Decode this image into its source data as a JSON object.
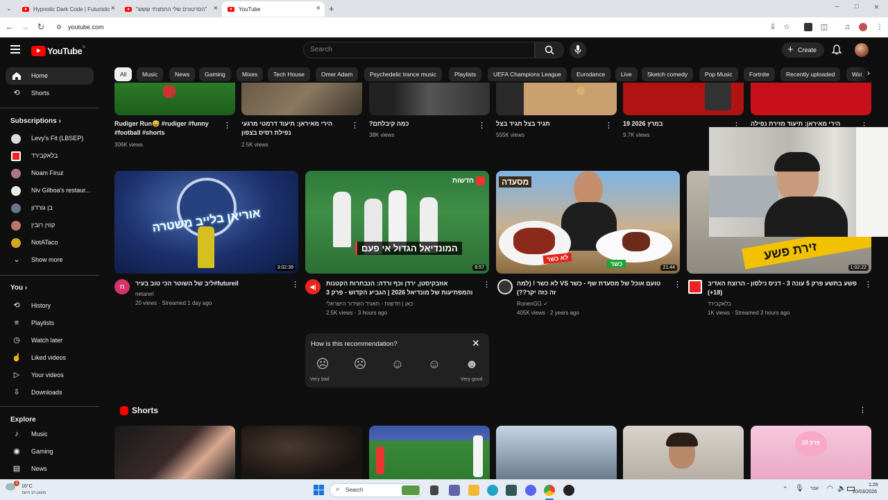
{
  "browser": {
    "tabs": [
      {
        "title": "Hypnotic Dark Code | Futuristic"
      },
      {
        "title": "\"הסרטונים שלי החמצתי ששש\""
      },
      {
        "title": "YouTube"
      }
    ],
    "url": "youtube.com"
  },
  "header": {
    "logo": "YouTube",
    "region": "IL",
    "search_placeholder": "Search",
    "create_label": "Create"
  },
  "chips": [
    "All",
    "Music",
    "News",
    "Gaming",
    "Mixes",
    "Tech House",
    "Omer Adam",
    "Psychedelic trance music",
    "Playlists",
    "UEFA Champions League",
    "Eurodance",
    "Live",
    "Sketch comedy",
    "Pop Music",
    "Fortnite",
    "Recently uploaded",
    "Wat"
  ],
  "sidebar": {
    "main": [
      {
        "label": "Home"
      },
      {
        "label": "Shorts"
      }
    ],
    "subscriptions_title": "Subscriptions",
    "subscriptions": [
      {
        "label": "Levy's Fit (LBSEP)"
      },
      {
        "label": "בלאקבירד"
      },
      {
        "label": "Noam Firuz"
      },
      {
        "label": "Niv Gilboa's restaur..."
      },
      {
        "label": "בן גורדון"
      },
      {
        "label": "קווין רובין"
      },
      {
        "label": "NotATaco"
      },
      {
        "label": "Show more"
      }
    ],
    "you_title": "You",
    "you": [
      {
        "label": "History"
      },
      {
        "label": "Playlists"
      },
      {
        "label": "Watch later"
      },
      {
        "label": "Liked videos"
      },
      {
        "label": "Your videos"
      },
      {
        "label": "Downloads"
      }
    ],
    "explore_title": "Explore",
    "explore": [
      {
        "label": "Music"
      },
      {
        "label": "Gaming"
      },
      {
        "label": "News"
      }
    ]
  },
  "row1": [
    {
      "title": "Rudiger Run😅 #rudiger #funny #football #shorts",
      "meta": "306K views"
    },
    {
      "title": "הירי מאיראן: תיעוד דרמטי מרגעי נפילת רסיס בצפון",
      "meta": "2.5K views"
    },
    {
      "title": "?כמה קיבלתם",
      "meta": "38K views"
    },
    {
      "title": "תגיד בצל תגיד בצל",
      "meta": "555K views"
    },
    {
      "title": "במרץ 2026 19",
      "meta": "9.7K views"
    },
    {
      "title": "הירי מאיראן: תיעוד מזירת נפילה באזור",
      "meta": ""
    }
  ],
  "row2": [
    {
      "title": "ליב של השוטר הכי טוב בעיר#futureil",
      "channel": "netanel",
      "meta": "20 views · Streamed 1 day ago",
      "duration": "3:02:39",
      "overlay": "אוריאן בלייב משטרה"
    },
    {
      "title": "אוזבקיסטן, ירדן וכף ורדה: הנבחרות הקטנות והמפתיעות של מונדיאל 2026 | הגביע הקדוש - פרק 3",
      "channel": "כאן | חדשות - תאגיד השידור הישראלי",
      "meta": "2.5K views · 3 hours ago",
      "duration": "8:57",
      "overlay": "המונדיאל הגדול אי פעם",
      "badge": "חדשות"
    },
    {
      "title": "טועם אוכל של מסעדת שף - כשר VS לא כשר ! (למה זה כזה יקר??)",
      "channel": "RonenGG",
      "meta": "405K views · 2 years ago",
      "duration": "21:44",
      "label_a": "לא כשר",
      "label_b": "כשר",
      "sign": "מסעדה"
    },
    {
      "title": "פשע בתשע פרק 5 עונה 3 - דניס נילסון - הרוצח האדיב (18+)",
      "channel": "בלאקבירד",
      "meta": "1K views · Streamed 3 hours ago",
      "duration": "1:02:22",
      "overlay": "זירת פשע"
    }
  ],
  "feedback": {
    "question": "How is this recommendation?",
    "low": "Very bad",
    "high": "Very good"
  },
  "shorts_title": "Shorts",
  "shorts_badge": "פרק 19",
  "taskbar": {
    "temp": "16°C",
    "weather": "מעונן רב היום",
    "search": "Search",
    "lang": "עבר",
    "time": "1:26",
    "date": "20/03/2026"
  }
}
